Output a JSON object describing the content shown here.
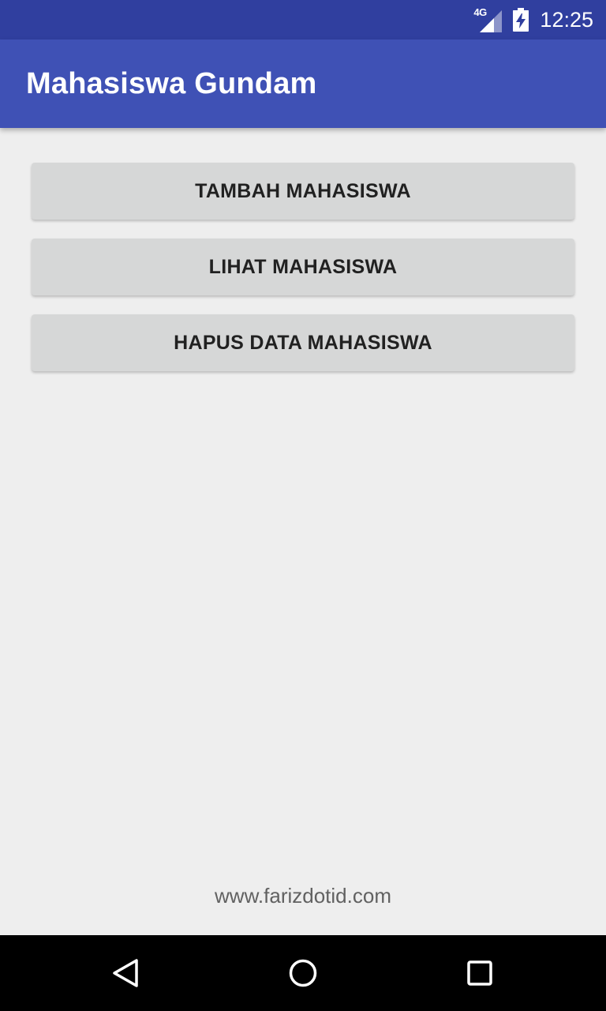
{
  "status_bar": {
    "network": "4G",
    "time": "12:25",
    "signal_icon": "signal-icon",
    "battery_icon": "battery-charging-icon"
  },
  "app_bar": {
    "title": "Mahasiswa Gundam",
    "color": "#3f51b5"
  },
  "buttons": [
    {
      "label": "TAMBAH MAHASISWA"
    },
    {
      "label": "LIHAT MAHASISWA"
    },
    {
      "label": "HAPUS DATA MAHASISWA"
    }
  ],
  "footer": {
    "text": "www.farizdotid.com"
  },
  "nav_bar": {
    "back_icon": "back-triangle-icon",
    "home_icon": "home-circle-icon",
    "recent_icon": "recent-apps-square-icon"
  },
  "colors": {
    "status_bar": "#303f9f",
    "primary": "#3f51b5",
    "background": "#eeeeee",
    "button": "#d6d7d7"
  }
}
